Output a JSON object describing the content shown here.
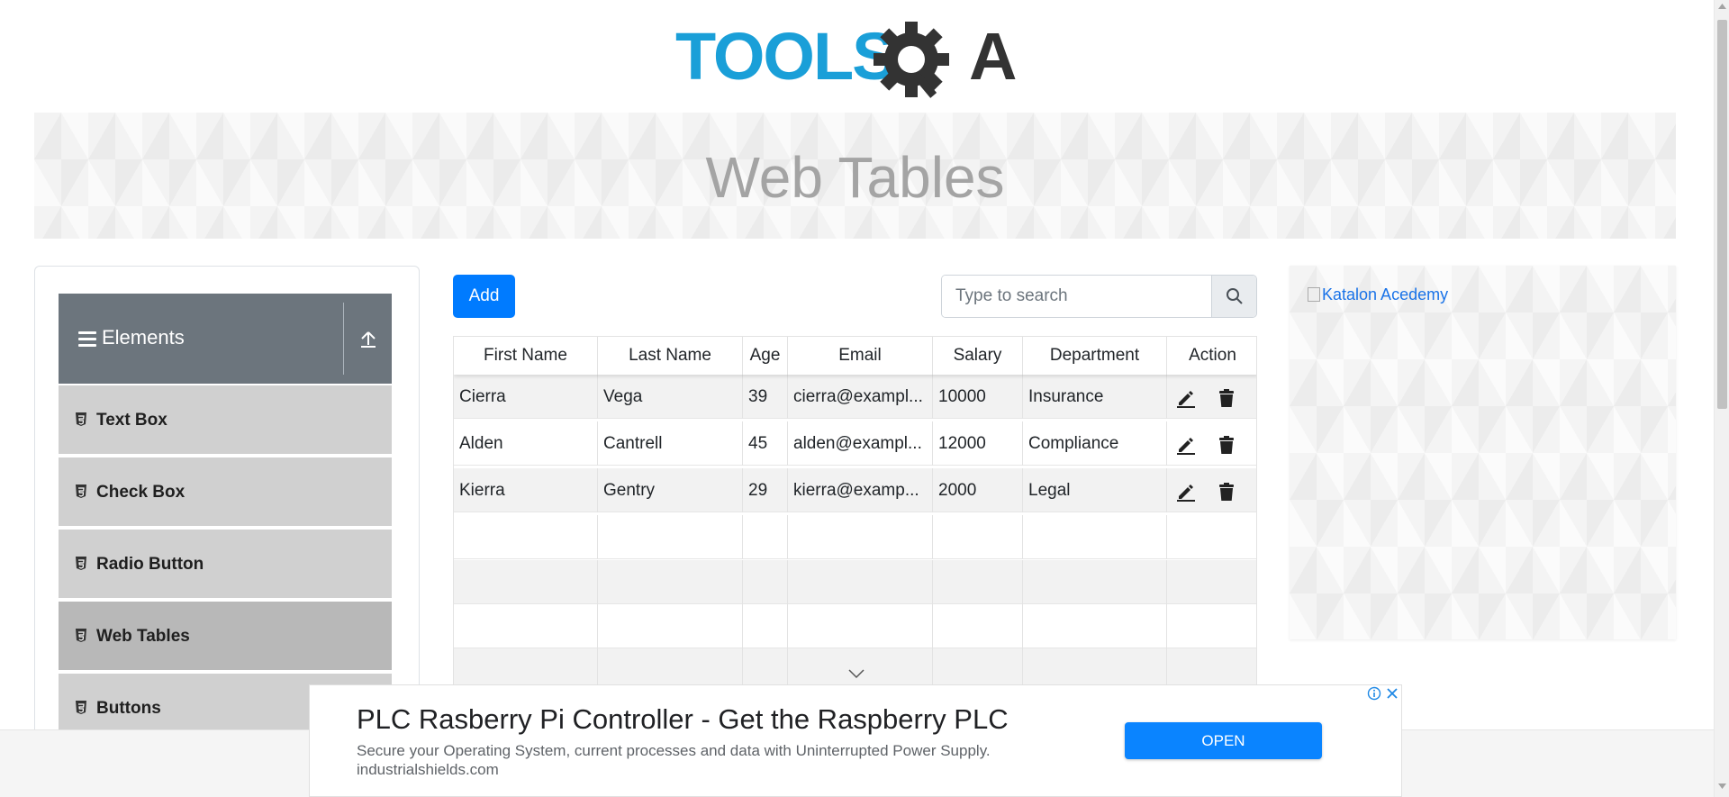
{
  "header": {
    "logo_text_left": "TOOLS",
    "logo_text_right": "A"
  },
  "banner": {
    "title": "Web Tables"
  },
  "sidebar": {
    "group_title": "Elements",
    "items": [
      {
        "label": "Text Box"
      },
      {
        "label": "Check Box"
      },
      {
        "label": "Radio Button"
      },
      {
        "label": "Web Tables"
      },
      {
        "label": "Buttons"
      }
    ]
  },
  "toolbar": {
    "add_label": "Add",
    "search_placeholder": "Type to search"
  },
  "table": {
    "headers": [
      "First Name",
      "Last Name",
      "Age",
      "Email",
      "Salary",
      "Department",
      "Action"
    ],
    "rows": [
      {
        "first": "Cierra",
        "last": "Vega",
        "age": "39",
        "email": "cierra@exampl...",
        "salary": "10000",
        "department": "Insurance"
      },
      {
        "first": "Alden",
        "last": "Cantrell",
        "age": "45",
        "email": "alden@exampl...",
        "salary": "12000",
        "department": "Compliance"
      },
      {
        "first": "Kierra",
        "last": "Gentry",
        "age": "29",
        "email": "kierra@examp...",
        "salary": "2000",
        "department": "Legal"
      }
    ]
  },
  "right_ad": {
    "alt_text": "Katalon Acedemy"
  },
  "bottom_ad": {
    "title": "PLC Rasberry Pi Controller - Get the Raspberry PLC",
    "description": "Secure your Operating System, current processes and data with Uninterrupted Power Supply.",
    "url": "industrialshields.com",
    "cta": "OPEN"
  },
  "colors": {
    "primary": "#007bff",
    "logo_blue": "#1a9fd8",
    "logo_dark": "#333333",
    "group_header": "#6c757d"
  }
}
